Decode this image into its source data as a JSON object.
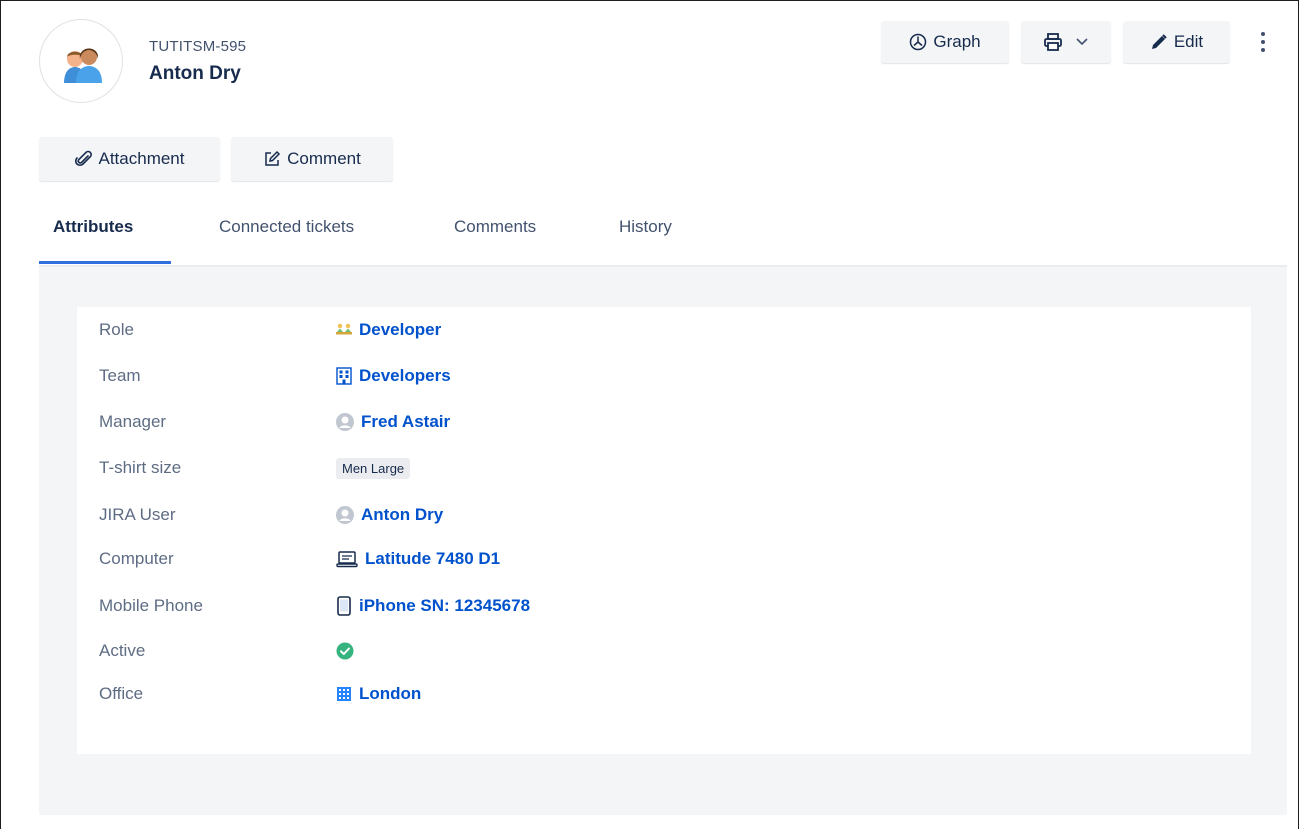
{
  "header": {
    "ticket_key": "TUTITSM-595",
    "title": "Anton Dry",
    "avatar_icon": "people-avatar-icon"
  },
  "toolbar": {
    "graph_label": "Graph",
    "edit_label": "Edit",
    "print_icon": "printer-icon",
    "more_icon": "vertical-ellipsis-icon"
  },
  "actions": {
    "attachment_label": "Attachment",
    "comment_label": "Comment"
  },
  "tabs": [
    {
      "label": "Attributes",
      "active": true
    },
    {
      "label": "Connected tickets",
      "active": false
    },
    {
      "label": "Comments",
      "active": false
    },
    {
      "label": "History",
      "active": false
    }
  ],
  "attributes": [
    {
      "label": "Role",
      "value": "Developer",
      "icon": "role-icon"
    },
    {
      "label": "Team",
      "value": "Developers",
      "icon": "building-icon"
    },
    {
      "label": "Manager",
      "value": "Fred Astair",
      "icon": "user-icon"
    },
    {
      "label": "T-shirt size",
      "value": "Men Large",
      "icon": ""
    },
    {
      "label": "JIRA User",
      "value": "Anton Dry",
      "icon": "user-icon"
    },
    {
      "label": "Computer",
      "value": "Latitude 7480 D1",
      "icon": "laptop-icon"
    },
    {
      "label": "Mobile Phone",
      "value": "iPhone SN: 12345678",
      "icon": "phone-icon"
    },
    {
      "label": "Active",
      "value": "",
      "icon": "check-circle-icon"
    },
    {
      "label": "Office",
      "value": "London",
      "icon": "office-building-icon"
    }
  ],
  "colors": {
    "link": "#0052cc",
    "tab_underline": "#2f6fde",
    "active_check": "#36b37e",
    "panel_bg": "#f4f5f7"
  }
}
